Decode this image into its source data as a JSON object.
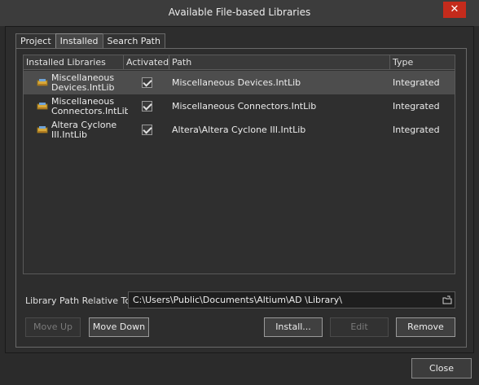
{
  "window": {
    "title": "Available File-based Libraries",
    "close_glyph": "✕"
  },
  "tabs": [
    {
      "label": "Project",
      "active": false
    },
    {
      "label": "Installed",
      "active": true
    },
    {
      "label": "Search Path",
      "active": false
    }
  ],
  "table": {
    "columns": [
      "Installed Libraries",
      "Activated",
      "Path",
      "Type"
    ],
    "rows": [
      {
        "name": "Miscellaneous Devices.IntLib",
        "activated": true,
        "path": "Miscellaneous Devices.IntLib",
        "type": "Integrated",
        "selected": true
      },
      {
        "name": "Miscellaneous Connectors.IntLib",
        "activated": true,
        "path": "Miscellaneous Connectors.IntLib",
        "type": "Integrated",
        "selected": false
      },
      {
        "name": "Altera Cyclone III.IntLib",
        "activated": true,
        "path": "Altera\\Altera Cyclone III.IntLib",
        "type": "Integrated",
        "selected": false
      }
    ]
  },
  "relative_path": {
    "label": "Library Path Relative To:",
    "value": "C:\\Users\\Public\\Documents\\Altium\\AD   \\Library\\"
  },
  "buttons": {
    "move_up": "Move Up",
    "move_down": "Move Down",
    "install": "Install...",
    "edit": "Edit",
    "remove": "Remove",
    "close": "Close"
  },
  "icons": {
    "library": "library-book-icon",
    "folder": "folder-browse-icon",
    "check": "checkmark-icon"
  },
  "colors": {
    "background": "#2b2b2b",
    "selected_row": "#4d4d4d",
    "close_red": "#c42b1c"
  }
}
